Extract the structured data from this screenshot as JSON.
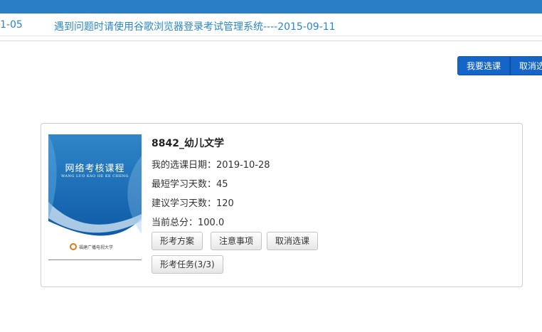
{
  "notice": {
    "previous_text": "1-05",
    "link_text": "遇到问题时请使用谷歌浏览器登录考试管理系统----2015-09-11"
  },
  "toolbar": {
    "select_course_label": "我要选课",
    "cancel_course_label": "取消选"
  },
  "course": {
    "cover": {
      "title": "网络考核课程",
      "subtitle": "WANG LUO KAO HE KE CHENG",
      "logo_text": "福建广播电视大学"
    },
    "name": "8842_幼儿文学",
    "fields": [
      {
        "label": "我的选课日期：",
        "value": "2019-10-28"
      },
      {
        "label": "最短学习天数：",
        "value": "45"
      },
      {
        "label": "建议学习天数：",
        "value": "120"
      },
      {
        "label": "当前总分：",
        "value": "100.0"
      }
    ],
    "buttons": {
      "assessment_plan": "形考方案",
      "notes": "注意事项",
      "cancel_selection": "取消选课",
      "assessment_tasks": "形考任务(3/3)"
    }
  },
  "colors": {
    "topbar": "#2a7ec4",
    "link": "#2a87c9",
    "primary_button": "#1565c8"
  }
}
